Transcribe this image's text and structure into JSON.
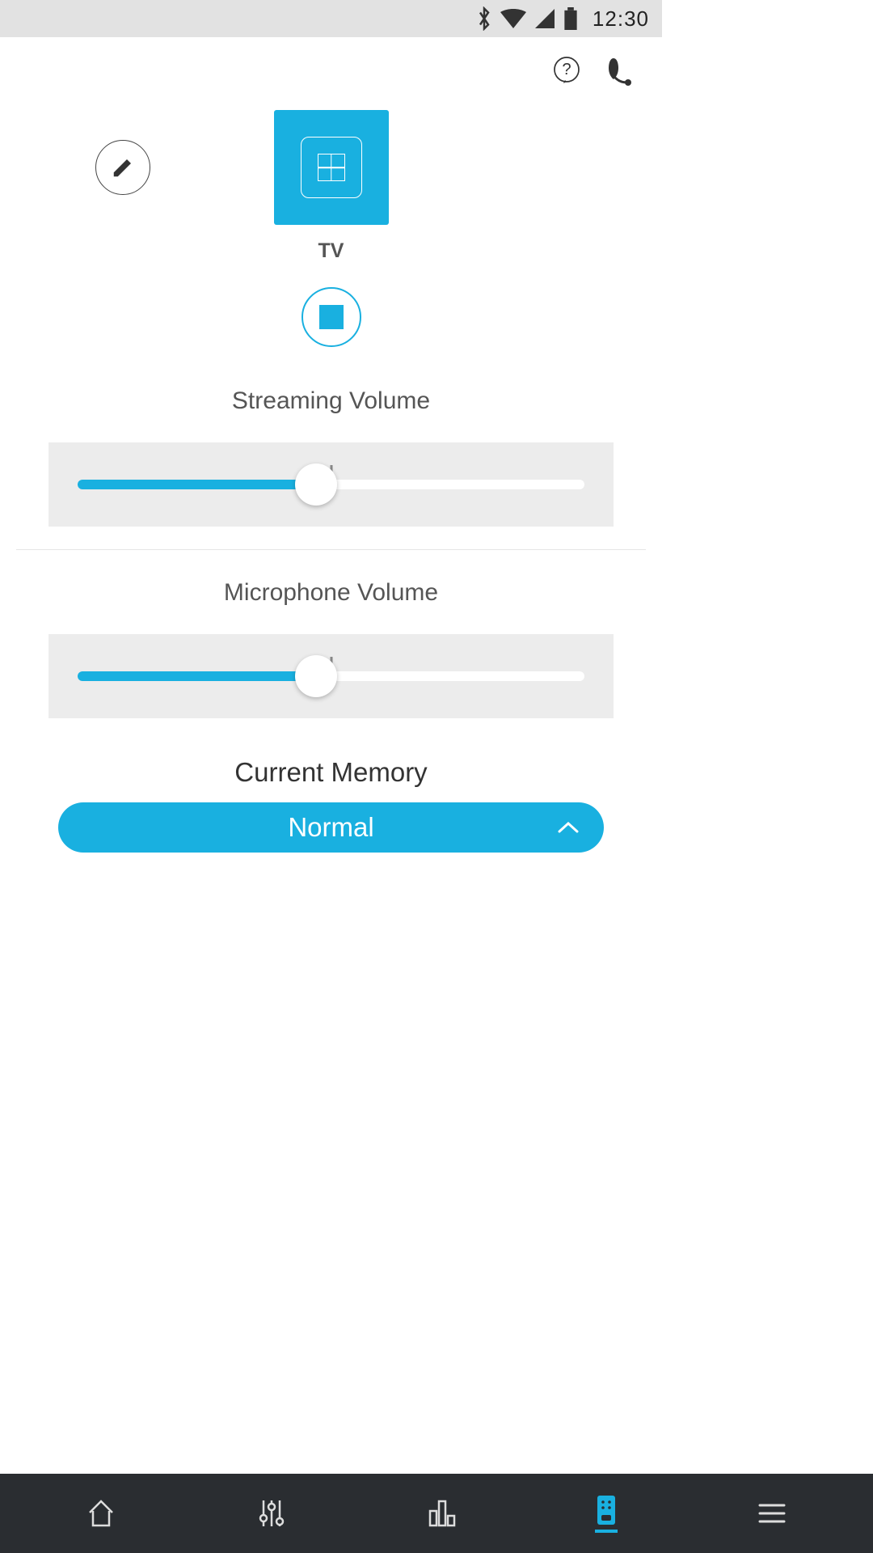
{
  "status": {
    "time": "12:30"
  },
  "device": {
    "label": "TV"
  },
  "sliders": {
    "streaming": {
      "label": "Streaming Volume",
      "percent": 47
    },
    "microphone": {
      "label": "Microphone Volume",
      "percent": 47
    }
  },
  "memory": {
    "label": "Current Memory",
    "value": "Normal"
  }
}
